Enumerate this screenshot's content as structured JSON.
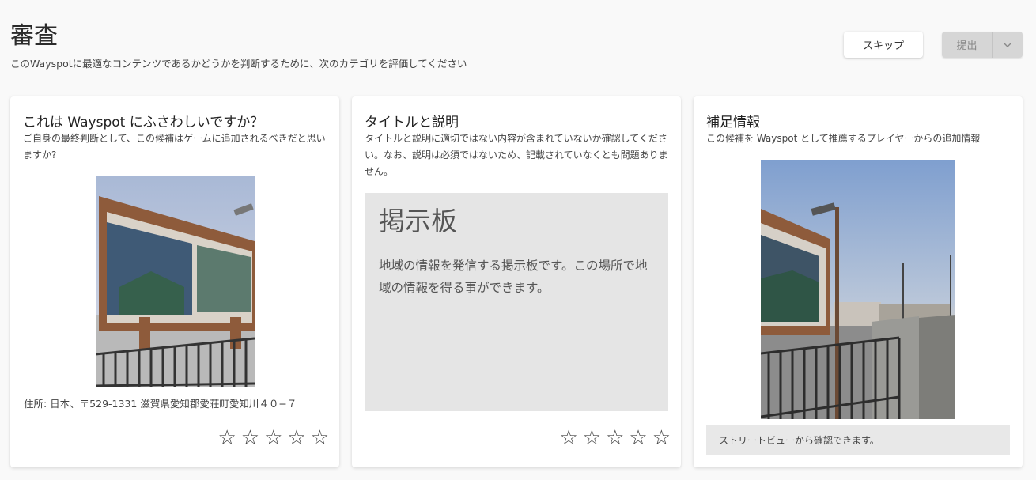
{
  "header": {
    "title": "審査",
    "subtitle": "このWayspotに最適なコンテンツであるかどうかを判断するために、次のカテゴリを評価してください",
    "skip_label": "スキップ",
    "submit_label": "提出",
    "dropdown_icon": "chevron-down-icon"
  },
  "cards": [
    {
      "title": "これは Wayspot にふさわしいですか？",
      "description": "ご自身の最終判断として、この候補はゲームに追加されるべきだと思いますか?",
      "address": "住所: 日本、〒529-1331 滋賀県愛知郡愛荘町愛知川４０−７",
      "stars": [
        "☆",
        "☆",
        "☆",
        "☆",
        "☆"
      ]
    },
    {
      "title": "タイトルと説明",
      "description": "タイトルと説明に適切ではない内容が含まれていないか確認してください。なお、説明は必須ではないため、記載されていなくとも問題ありません。",
      "poi_title": "掲示板",
      "poi_description": "地域の情報を発信する掲示板です。この場所で地域の情報を得る事ができます。",
      "stars": [
        "☆",
        "☆",
        "☆",
        "☆",
        "☆"
      ]
    },
    {
      "title": "補足情報",
      "description": "この候補を Wayspot として推薦するプレイヤーからの追加情報",
      "streetview_note": "ストリートビューから確認できます。"
    }
  ],
  "colors": {
    "background": "#f9f9f9",
    "card": "#ffffff",
    "submit_disabled": "#d6d6d6"
  }
}
